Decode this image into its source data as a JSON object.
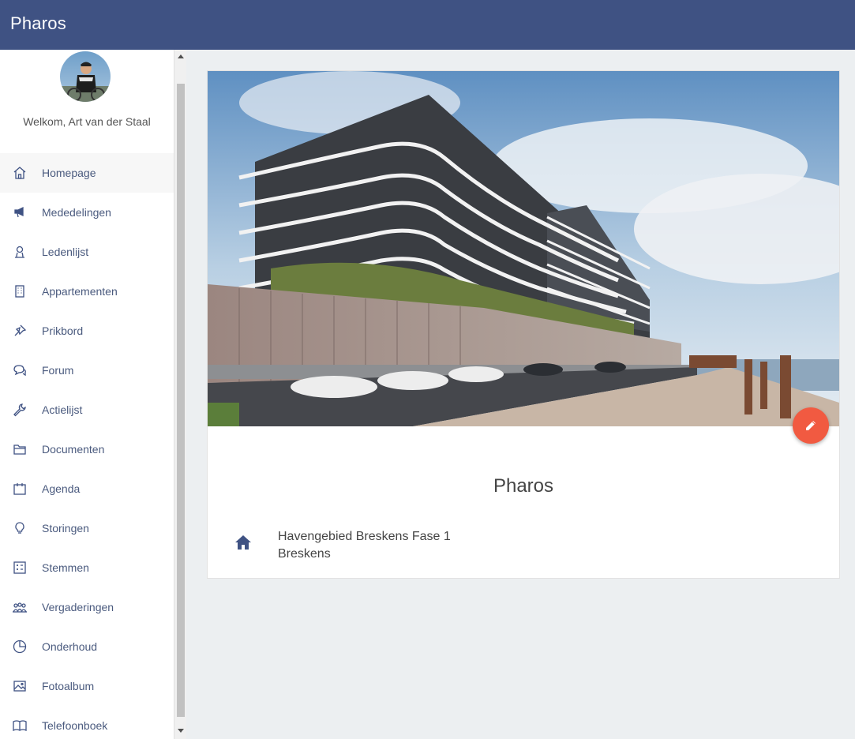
{
  "app": {
    "title": "Pharos"
  },
  "user": {
    "welcome": "Welkom, Art van der Staal"
  },
  "sidebar": {
    "items": [
      {
        "label": "Homepage",
        "icon": "home-icon",
        "active": true
      },
      {
        "label": "Mededelingen",
        "icon": "megaphone-icon"
      },
      {
        "label": "Ledenlijst",
        "icon": "person-icon"
      },
      {
        "label": "Appartementen",
        "icon": "building-icon"
      },
      {
        "label": "Prikbord",
        "icon": "pin-icon"
      },
      {
        "label": "Forum",
        "icon": "chat-icon"
      },
      {
        "label": "Actielijst",
        "icon": "wrench-icon"
      },
      {
        "label": "Documenten",
        "icon": "folder-icon"
      },
      {
        "label": "Agenda",
        "icon": "calendar-icon"
      },
      {
        "label": "Storingen",
        "icon": "lightbulb-icon"
      },
      {
        "label": "Stemmen",
        "icon": "ballot-icon"
      },
      {
        "label": "Vergaderingen",
        "icon": "meeting-icon"
      },
      {
        "label": "Onderhoud",
        "icon": "pie-icon"
      },
      {
        "label": "Fotoalbum",
        "icon": "image-icon"
      },
      {
        "label": "Telefoonboek",
        "icon": "book-icon"
      }
    ]
  },
  "card": {
    "title": "Pharos",
    "address_line1": "Havengebied Breskens Fase 1",
    "address_line2": "Breskens"
  },
  "colors": {
    "header": "#3f5283",
    "fab": "#f15a41",
    "accent": "#3f5283"
  }
}
